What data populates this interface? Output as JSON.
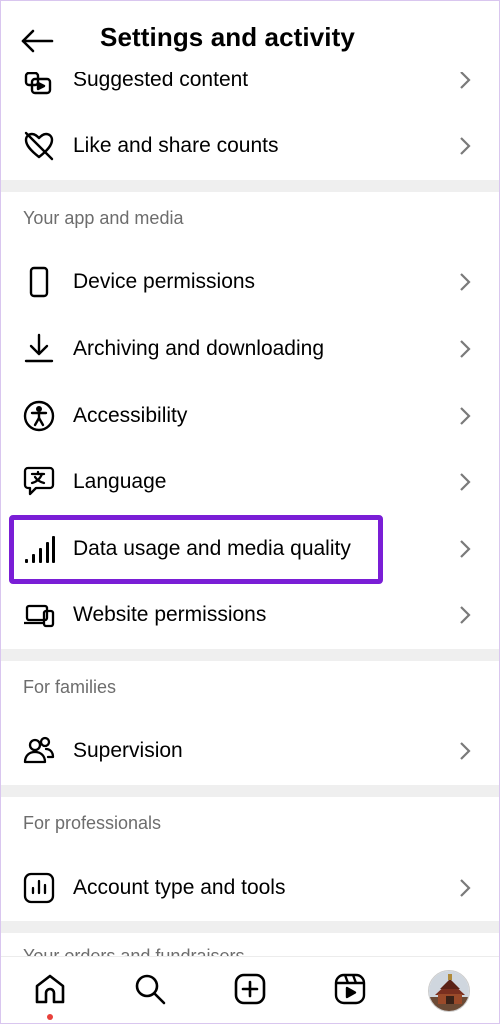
{
  "header": {
    "title": "Settings and activity"
  },
  "rows_top": [
    {
      "label": "Suggested content",
      "icon": "suggested-content-icon"
    },
    {
      "label": "Like and share counts",
      "icon": "hidden-likes-icon"
    }
  ],
  "sections": {
    "app_media": {
      "title": "Your app and media",
      "items": [
        {
          "label": "Device permissions",
          "icon": "phone-icon"
        },
        {
          "label": "Archiving and downloading",
          "icon": "download-icon"
        },
        {
          "label": "Accessibility",
          "icon": "accessibility-icon"
        },
        {
          "label": "Language",
          "icon": "language-icon"
        },
        {
          "label": "Data usage and media quality",
          "icon": "signal-bars-icon"
        },
        {
          "label": "Website permissions",
          "icon": "laptop-phone-icon"
        }
      ]
    },
    "families": {
      "title": "For families",
      "items": [
        {
          "label": "Supervision",
          "icon": "people-icon"
        }
      ]
    },
    "professionals": {
      "title": "For professionals",
      "items": [
        {
          "label": "Account type and tools",
          "icon": "chart-icon"
        }
      ]
    },
    "next": {
      "title": "Your orders and fundraisers"
    }
  },
  "highlight_color": "#7a1ed6",
  "bottom_nav": [
    "home-icon",
    "search-icon",
    "create-icon",
    "reels-icon",
    "profile-avatar"
  ],
  "notification_dot_color": "#e8413b"
}
